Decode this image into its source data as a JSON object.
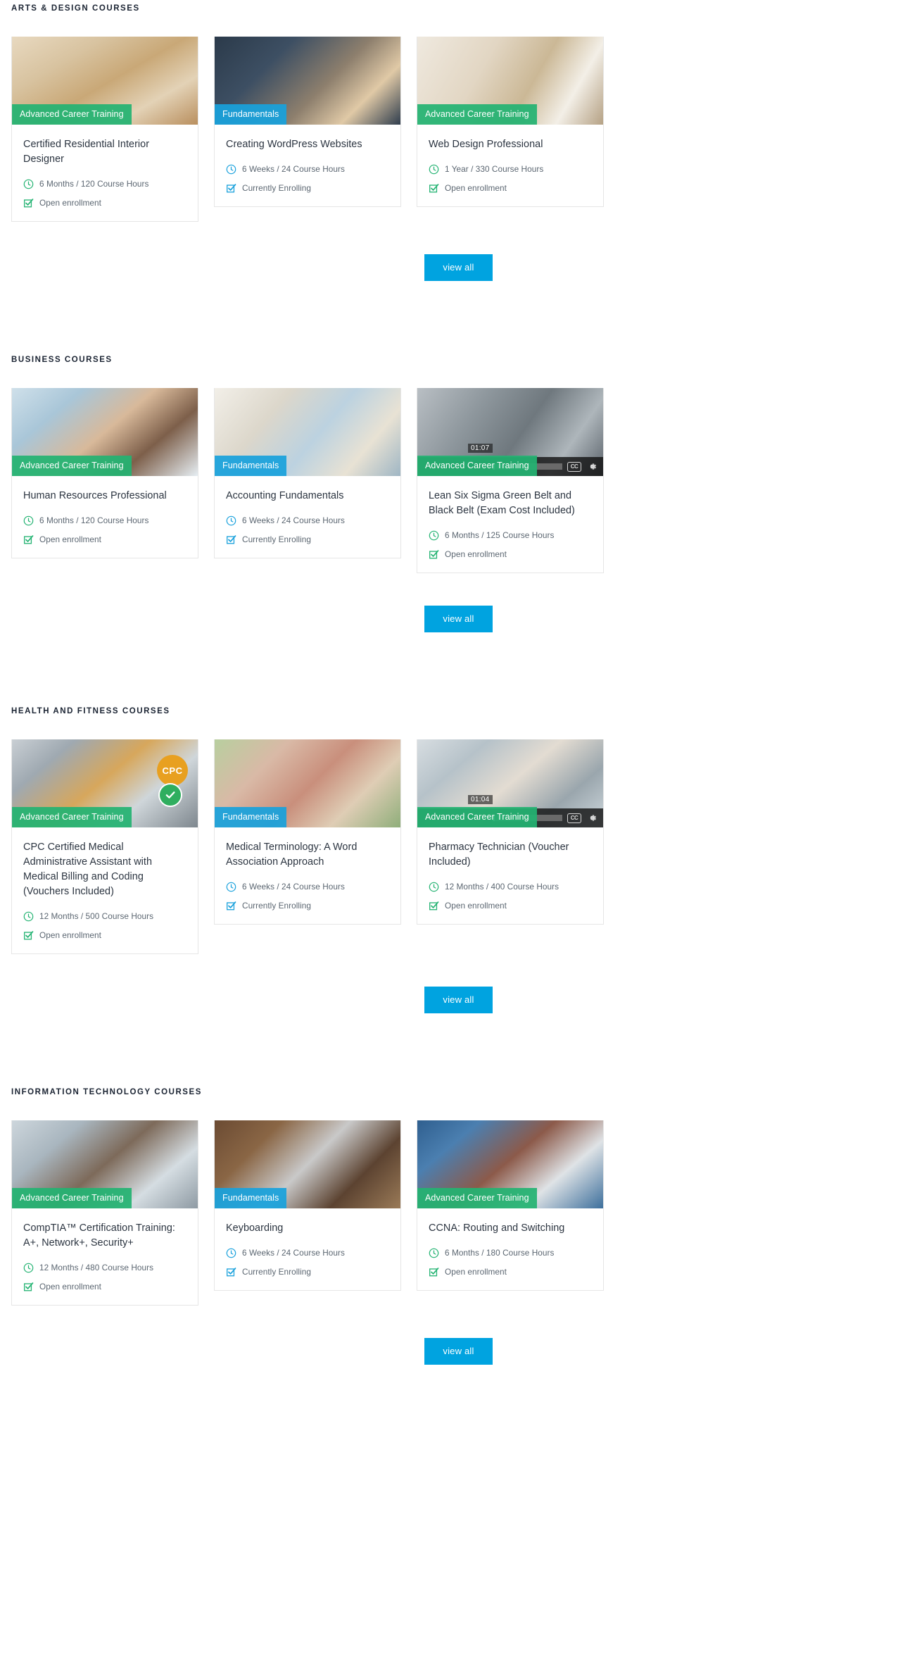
{
  "colors": {
    "accent_blue": "#00a3e0",
    "badge_green": "#23b372",
    "badge_blue": "#19a1dc",
    "title_text": "#2b3440",
    "meta_text": "#5b6671",
    "header_text": "#1a2332",
    "card_border": "#e6e6e6"
  },
  "view_all_label": "view all",
  "icons": {
    "duration": "clock-icon",
    "enrollment": "checkbox-checked-icon",
    "captions": "closed-captions-icon",
    "settings": "gear-icon"
  },
  "sections": [
    {
      "id": "arts-design",
      "title": "ARTS & DESIGN COURSES",
      "view_all_label": "view all",
      "cards": [
        {
          "badge": "Advanced Career Training",
          "badge_type": "green",
          "photo": "ph-interior",
          "title": "Certified Residential Interior Designer",
          "duration": "6 Months / 120 Course Hours",
          "enrollment": "Open enrollment",
          "has_video": false
        },
        {
          "badge": "Fundamentals",
          "badge_type": "blue",
          "photo": "ph-laptop",
          "title": "Creating WordPress Websites",
          "duration": "6 Weeks / 24 Course Hours",
          "enrollment": "Currently Enrolling",
          "has_video": false
        },
        {
          "badge": "Advanced Career Training",
          "badge_type": "green",
          "photo": "ph-layout",
          "title": "Web Design Professional",
          "duration": "1 Year / 330 Course Hours",
          "enrollment": "Open enrollment",
          "has_video": false
        }
      ]
    },
    {
      "id": "business",
      "title": "BUSINESS COURSES",
      "view_all_label": "view all",
      "cards": [
        {
          "badge": "Advanced Career Training",
          "badge_type": "green",
          "photo": "ph-hr",
          "title": "Human Resources Professional",
          "duration": "6 Months / 120 Course Hours",
          "enrollment": "Open enrollment",
          "has_video": false
        },
        {
          "badge": "Fundamentals",
          "badge_type": "blue",
          "photo": "ph-acct",
          "title": "Accounting Fundamentals",
          "duration": "6 Weeks / 24 Course Hours",
          "enrollment": "Currently Enrolling",
          "has_video": false
        },
        {
          "badge": "Advanced Career Training",
          "badge_type": "green",
          "photo": "ph-sixsigma",
          "title": "Lean Six Sigma Green Belt and Black Belt (Exam Cost Included)",
          "duration": "6 Months / 125 Course Hours",
          "enrollment": "Open enrollment",
          "has_video": true,
          "video_time": "01:07",
          "cc_label": "CC"
        }
      ]
    },
    {
      "id": "health-fitness",
      "title": "HEALTH AND FITNESS COURSES",
      "view_all_label": "view all",
      "cards": [
        {
          "badge": "Advanced Career Training",
          "badge_type": "green",
          "photo": "ph-cpc",
          "title": "CPC Certified Medical Administrative Assistant with Medical Billing and Coding (Vouchers Included)",
          "duration": "12 Months / 500 Course Hours",
          "enrollment": "Open enrollment",
          "has_video": false,
          "cpc_seal": "CPC"
        },
        {
          "badge": "Fundamentals",
          "badge_type": "blue",
          "photo": "ph-medterm",
          "title": "Medical Terminology: A Word Association Approach",
          "duration": "6 Weeks / 24 Course Hours",
          "enrollment": "Currently Enrolling",
          "has_video": false
        },
        {
          "badge": "Advanced Career Training",
          "badge_type": "green",
          "photo": "ph-pharm",
          "title": "Pharmacy Technician (Voucher Included)",
          "duration": "12 Months / 400 Course Hours",
          "enrollment": "Open enrollment",
          "has_video": true,
          "video_time": "01:04",
          "cc_label": "CC"
        }
      ]
    },
    {
      "id": "information-technology",
      "title": "INFORMATION TECHNOLOGY COURSES",
      "view_all_label": "view all",
      "cards": [
        {
          "badge": "Advanced Career Training",
          "badge_type": "green",
          "photo": "ph-comptia",
          "title": "CompTIA™ Certification Training: A+, Network+, Security+",
          "duration": "12 Months / 480 Course Hours",
          "enrollment": "Open enrollment",
          "has_video": false
        },
        {
          "badge": "Fundamentals",
          "badge_type": "blue",
          "photo": "ph-keyboard",
          "title": "Keyboarding",
          "duration": "6 Weeks / 24 Course Hours",
          "enrollment": "Currently Enrolling",
          "has_video": false
        },
        {
          "badge": "Advanced Career Training",
          "badge_type": "green",
          "photo": "ph-ccna",
          "title": "CCNA: Routing and Switching",
          "duration": "6 Months / 180 Course Hours",
          "enrollment": "Open enrollment",
          "has_video": false
        }
      ]
    }
  ]
}
